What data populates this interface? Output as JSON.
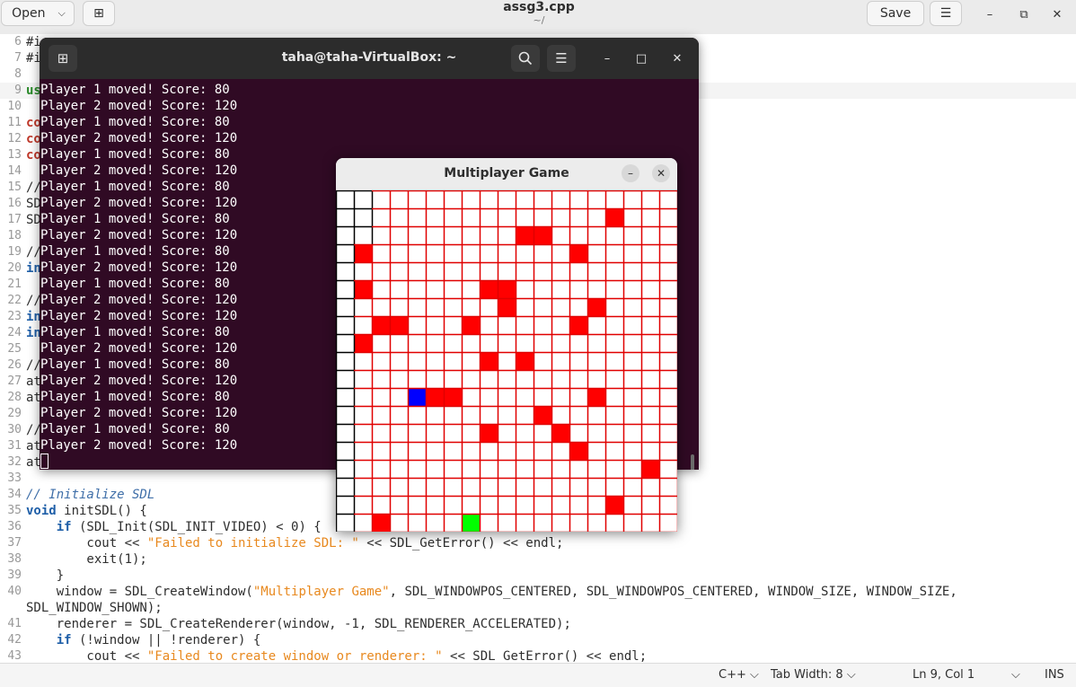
{
  "editor_window": {
    "title": "assg3.cpp",
    "subtitle": "~/",
    "open_label": "Open",
    "save_label": "Save"
  },
  "code_lines": [
    {
      "n": "6",
      "text": "#i"
    },
    {
      "n": "7",
      "text": "#i"
    },
    {
      "n": "8",
      "text": ""
    },
    {
      "n": "9",
      "text": "us"
    },
    {
      "n": "10",
      "text": ""
    },
    {
      "n": "11",
      "text": "co"
    },
    {
      "n": "12",
      "text": "co"
    },
    {
      "n": "13",
      "text": "co"
    },
    {
      "n": "14",
      "text": ""
    },
    {
      "n": "15",
      "text": "//"
    },
    {
      "n": "16",
      "text": "SD"
    },
    {
      "n": "17",
      "text": "SD"
    },
    {
      "n": "18",
      "text": ""
    },
    {
      "n": "19",
      "text": "//"
    },
    {
      "n": "20",
      "text": "in"
    },
    {
      "n": "21",
      "text": ""
    },
    {
      "n": "22",
      "text": "//"
    },
    {
      "n": "23",
      "text": "in"
    },
    {
      "n": "24",
      "text": "in"
    },
    {
      "n": "25",
      "text": ""
    },
    {
      "n": "26",
      "text": "//"
    },
    {
      "n": "27",
      "text": "at"
    },
    {
      "n": "28",
      "text": "at"
    },
    {
      "n": "29",
      "text": ""
    },
    {
      "n": "30",
      "text": "//"
    },
    {
      "n": "31",
      "text": "at"
    },
    {
      "n": "32",
      "text": "at"
    },
    {
      "n": "33",
      "text": ""
    },
    {
      "n": "34",
      "text": "// Initialize SDL"
    },
    {
      "n": "35",
      "text": "void initSDL() {"
    },
    {
      "n": "36",
      "text": "    if (SDL_Init(SDL_INIT_VIDEO) < 0) {"
    },
    {
      "n": "37",
      "text": "        cout << \"Failed to initialize SDL: \" << SDL_GetError() << endl;"
    },
    {
      "n": "38",
      "text": "        exit(1);"
    },
    {
      "n": "39",
      "text": "    }"
    },
    {
      "n": "40",
      "text": "    window = SDL_CreateWindow(\"Multiplayer Game\", SDL_WINDOWPOS_CENTERED, SDL_WINDOWPOS_CENTERED, WINDOW_SIZE, WINDOW_SIZE,"
    },
    {
      "n": "",
      "text": "SDL_WINDOW_SHOWN);"
    },
    {
      "n": "41",
      "text": "    renderer = SDL_CreateRenderer(window, -1, SDL_RENDERER_ACCELERATED);"
    },
    {
      "n": "42",
      "text": "    if (!window || !renderer) {"
    },
    {
      "n": "43",
      "text": "        cout << \"Failed to create window or renderer: \" << SDL_GetError() << endl;"
    }
  ],
  "statusbar": {
    "language": "C++",
    "tab_width": "Tab Width: 8",
    "position": "Ln 9, Col 1",
    "mode": "INS"
  },
  "terminal": {
    "title": "taha@taha-VirtualBox: ~",
    "lines": [
      "Player 1 moved! Score: 80",
      "Player 2 moved! Score: 120",
      "Player 1 moved! Score: 80",
      "Player 2 moved! Score: 120",
      "Player 1 moved! Score: 80",
      "Player 2 moved! Score: 120",
      "Player 1 moved! Score: 80",
      "Player 2 moved! Score: 120",
      "Player 1 moved! Score: 80",
      "Player 2 moved! Score: 120",
      "Player 1 moved! Score: 80",
      "Player 2 moved! Score: 120",
      "Player 1 moved! Score: 80",
      "Player 2 moved! Score: 120",
      "Player 2 moved! Score: 120",
      "Player 1 moved! Score: 80",
      "Player 2 moved! Score: 120",
      "Player 1 moved! Score: 80",
      "Player 2 moved! Score: 120",
      "Player 1 moved! Score: 80",
      "Player 2 moved! Score: 120",
      "Player 1 moved! Score: 80",
      "Player 2 moved! Score: 120"
    ]
  },
  "game_window": {
    "title": "Multiplayer Game",
    "grid": {
      "cols": 19,
      "rows": 19,
      "line_color": "#e00000",
      "first_cols_line_color": "#000000",
      "filled_red": [
        [
          15,
          1
        ],
        [
          10,
          2
        ],
        [
          11,
          2
        ],
        [
          1,
          3
        ],
        [
          13,
          3
        ],
        [
          1,
          5
        ],
        [
          8,
          5
        ],
        [
          9,
          5
        ],
        [
          9,
          6
        ],
        [
          14,
          6
        ],
        [
          2,
          7
        ],
        [
          3,
          7
        ],
        [
          7,
          7
        ],
        [
          13,
          7
        ],
        [
          1,
          8
        ],
        [
          8,
          9
        ],
        [
          10,
          9
        ],
        [
          5,
          11
        ],
        [
          6,
          11
        ],
        [
          14,
          11
        ],
        [
          11,
          12
        ],
        [
          8,
          13
        ],
        [
          12,
          13
        ],
        [
          13,
          14
        ],
        [
          17,
          15
        ],
        [
          15,
          17
        ],
        [
          2,
          18
        ]
      ],
      "player_blue": [
        4,
        11
      ],
      "player_green": [
        7,
        18
      ]
    }
  },
  "colors": {
    "terminal_bg": "#300a24",
    "cell_red": "#ff0000",
    "player1": "#0000ff",
    "player2": "#00ff00"
  }
}
